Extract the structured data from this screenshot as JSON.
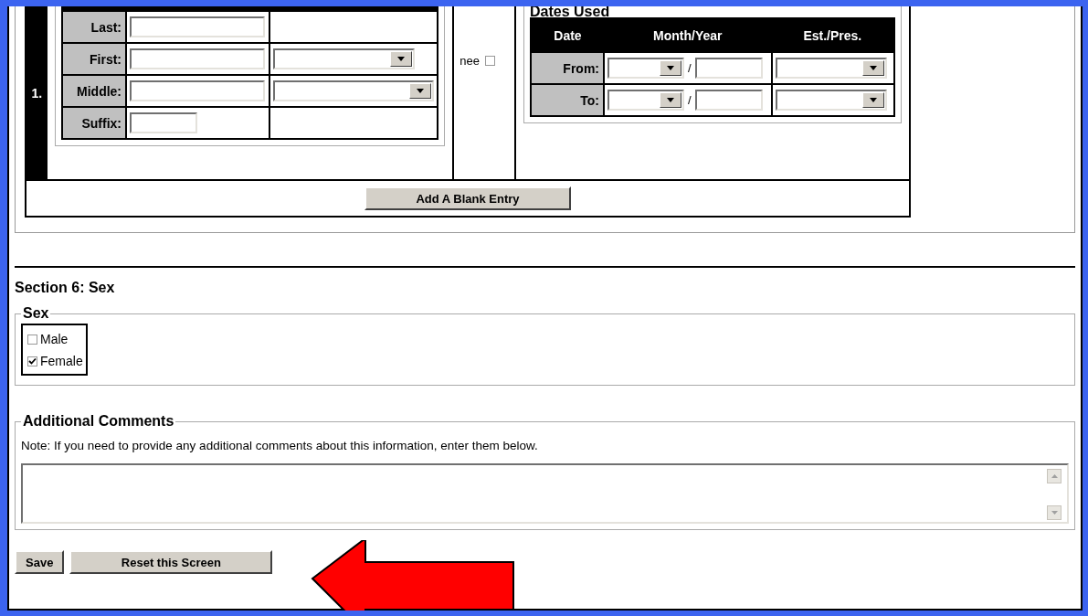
{
  "entry": {
    "number": "1.",
    "name_fields": [
      {
        "label": "Last:",
        "kind": "input"
      },
      {
        "label": "First:",
        "kind": "input_select"
      },
      {
        "label": "Middle:",
        "kind": "input_wide_select"
      },
      {
        "label": "Suffix:",
        "kind": "short_input"
      }
    ],
    "nee": {
      "label": "nee",
      "checked": false
    },
    "dates_used": {
      "title": "Dates Used",
      "columns": [
        "Date",
        "Month/Year",
        "Est./Pres."
      ],
      "rows": [
        {
          "label": "From:",
          "separator": "/"
        },
        {
          "label": "To:",
          "separator": "/"
        }
      ]
    },
    "add_button": "Add A Blank Entry"
  },
  "section6": {
    "heading": "Section 6: Sex",
    "legend": "Sex",
    "options": [
      {
        "label": "Male",
        "checked": false
      },
      {
        "label": "Female",
        "checked": true
      }
    ]
  },
  "comments": {
    "legend": "Additional Comments",
    "note": "Note: If you need to provide any additional comments about this information, enter them below."
  },
  "buttons": [
    "Save",
    "Reset this Screen"
  ]
}
